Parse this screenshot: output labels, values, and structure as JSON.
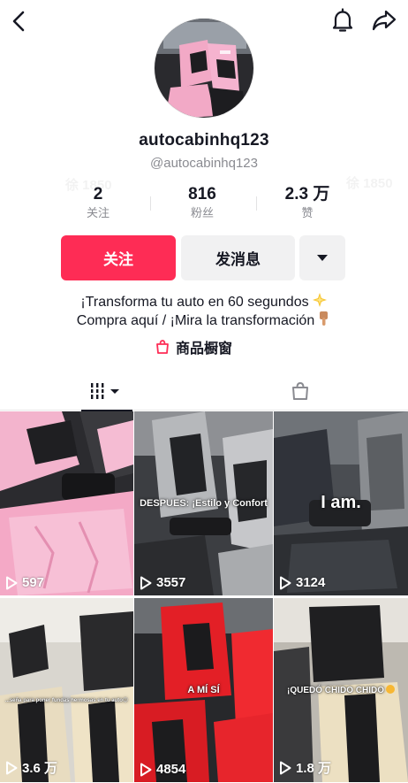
{
  "profile": {
    "username": "autocabinhq123",
    "handle": "@autocabinhq123",
    "watermark": "徐 1850"
  },
  "stats": [
    {
      "value": "2",
      "label": "关注"
    },
    {
      "value": "816",
      "label": "粉丝"
    },
    {
      "value": "2.3 万",
      "label": "赞"
    }
  ],
  "actions": {
    "follow_label": "关注",
    "message_label": "发消息"
  },
  "bio": {
    "line1": "¡Transforma tu auto en 60 segundos",
    "line2": "Compra aquí / ¡Mira la transformación"
  },
  "shop": {
    "label": "商品橱窗"
  },
  "videos": [
    {
      "views": "597",
      "caption": ""
    },
    {
      "views": "3557",
      "caption": "DESPUES: ¡Estilo y Confort"
    },
    {
      "views": "3124",
      "caption": "I am."
    },
    {
      "views": "3.6 万",
      "caption": "...seña para poner fundas hermosas en tu auto😊"
    },
    {
      "views": "4854",
      "caption": "A MÍ SÍ"
    },
    {
      "views": "1.8 万",
      "caption": "¡QUEDÓ CHIDO CHIDO"
    }
  ],
  "colors": {
    "accent": "#fe2c55",
    "secondary_button": "#f1f1f2",
    "text": "#161823",
    "muted": "#8a8b91"
  },
  "icons": [
    "back-icon",
    "bell-icon",
    "share-icon",
    "shopping-bag-icon",
    "grid-icon",
    "shop-tab-icon",
    "play-icon"
  ]
}
